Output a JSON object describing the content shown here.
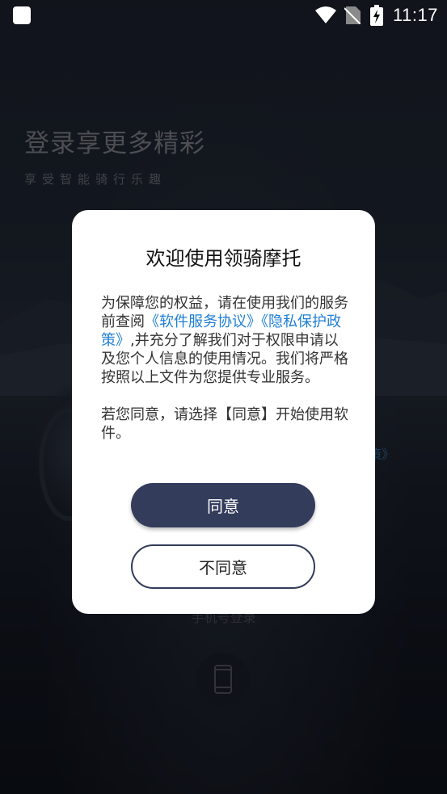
{
  "status_bar": {
    "time": "11:17",
    "icons": [
      "app-icon",
      "wifi-icon",
      "no-sim-icon",
      "battery-charging-icon"
    ]
  },
  "background": {
    "title": "登录享更多精彩",
    "subtitle": "享受智能骑行乐趣",
    "policy_fragment": "策》",
    "phone_login_label": "手机号登录",
    "phone_login_icon": "phone-icon"
  },
  "dialog": {
    "title": "欢迎使用领骑摩托",
    "para1_prefix": "为保障您的权益，请在使用我们的服务前查阅",
    "link_service": "《软件服务协议》",
    "link_privacy": "《隐私保护政策》",
    "para1_suffix": ",并充分了解我们对于权限申请以及您个人信息的使用情况。我们将严格按照以上文件为您提供专业服务。",
    "para2": "若您同意，请选择【同意】开始使用软件。",
    "agree_label": "同意",
    "disagree_label": "不同意"
  },
  "colors": {
    "accent": "#333c5b",
    "link": "#1f7fd6"
  }
}
